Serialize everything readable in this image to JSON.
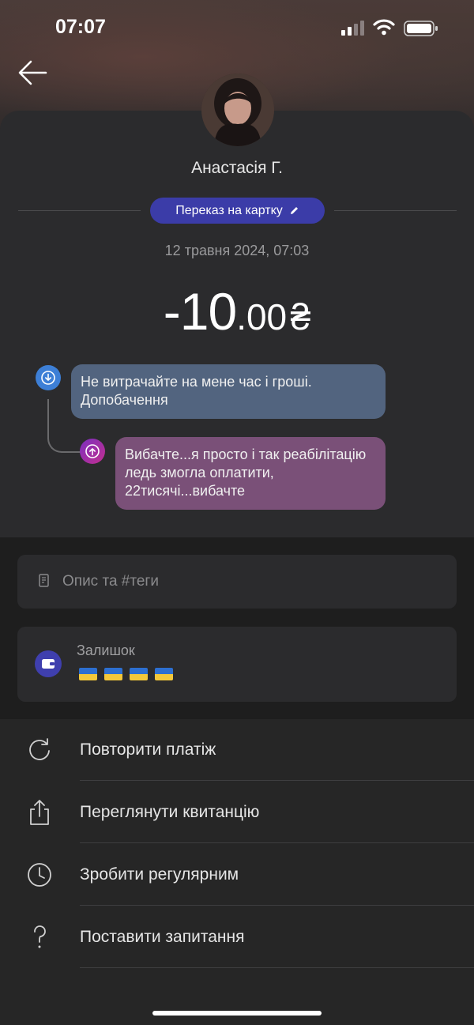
{
  "status_bar": {
    "time": "07:07"
  },
  "contact": {
    "name": "Анастасія Г."
  },
  "category": {
    "label": "Переказ на картку"
  },
  "transaction": {
    "date": "12 травня 2024, 07:03",
    "amount_int": "-10",
    "amount_dec": ".00",
    "currency": "₴"
  },
  "messages": [
    {
      "direction": "incoming",
      "text": "Не витрачайте на мене час і гроші. Допобачення"
    },
    {
      "direction": "outgoing",
      "text": "Вибачте...я просто і так реабілітацію ледь змогла оплатити, 22тисячі...вибачте"
    }
  ],
  "description": {
    "placeholder": "Опис та #теги"
  },
  "balance": {
    "label": "Залишок",
    "flags": [
      "ua-flag",
      "ua-flag",
      "ua-flag",
      "ua-flag"
    ]
  },
  "actions": [
    {
      "label": "Повторити платіж",
      "icon": "repeat-icon"
    },
    {
      "label": "Переглянути квитанцію",
      "icon": "share-icon"
    },
    {
      "label": "Зробити регулярним",
      "icon": "clock-icon"
    },
    {
      "label": "Поставити запитання",
      "icon": "question-icon"
    }
  ],
  "colors": {
    "accent": "#3b3ca8",
    "incoming_bubble": "#52647f",
    "outgoing_bubble": "#7a5078",
    "background": "#262626"
  }
}
